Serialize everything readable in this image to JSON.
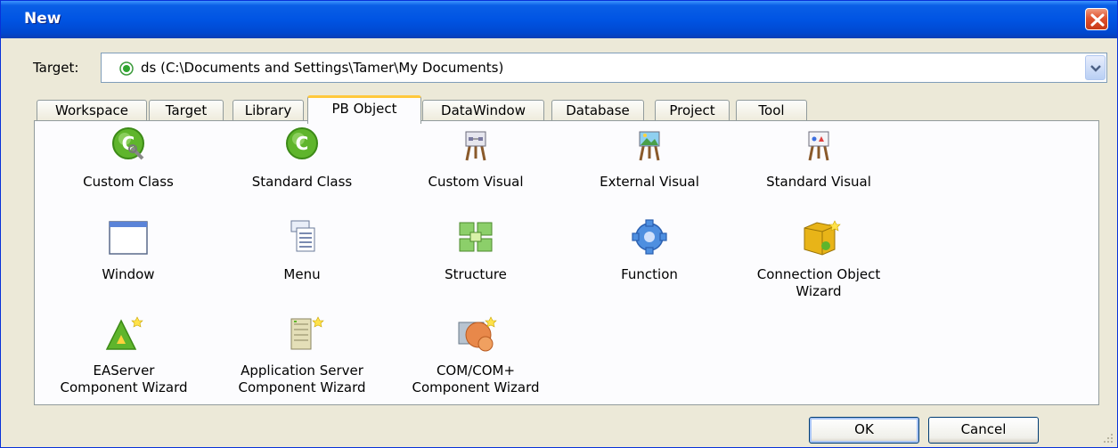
{
  "window": {
    "title": "New"
  },
  "target": {
    "label": "Target:",
    "value": "ds (C:\\Documents and Settings\\Tamer\\My Documents)"
  },
  "tabs": [
    {
      "label": "Workspace",
      "active": false
    },
    {
      "label": "Target",
      "active": false
    },
    {
      "label": "Library",
      "active": false
    },
    {
      "label": "PB Object",
      "active": true
    },
    {
      "label": "DataWindow",
      "active": false
    },
    {
      "label": "Database",
      "active": false
    },
    {
      "label": "Project",
      "active": false
    },
    {
      "label": "Tool",
      "active": false
    }
  ],
  "items": [
    {
      "label": "Custom Class",
      "icon": "custom-class-icon"
    },
    {
      "label": "Standard Class",
      "icon": "standard-class-icon"
    },
    {
      "label": "Custom Visual",
      "icon": "custom-visual-icon"
    },
    {
      "label": "External Visual",
      "icon": "external-visual-icon"
    },
    {
      "label": "Standard Visual",
      "icon": "standard-visual-icon"
    },
    {
      "label": "Window",
      "icon": "window-icon"
    },
    {
      "label": "Menu",
      "icon": "menu-icon"
    },
    {
      "label": "Structure",
      "icon": "structure-icon"
    },
    {
      "label": "Function",
      "icon": "function-icon"
    },
    {
      "label1": "Connection Object",
      "label2": "Wizard",
      "icon": "connection-wizard-icon"
    },
    {
      "label1": "EAServer",
      "label2": "Component Wizard",
      "icon": "easerver-wizard-icon"
    },
    {
      "label1": "Application Server",
      "label2": "Component Wizard",
      "icon": "app-server-wizard-icon"
    },
    {
      "label1": "COM/COM+",
      "label2": "Component Wizard",
      "icon": "com-wizard-icon"
    }
  ],
  "buttons": {
    "ok": "OK",
    "cancel": "Cancel"
  },
  "colors": {
    "titlebar": "#0054e3",
    "dialog_bg": "#ece9d8",
    "active_tab_accent": "#ffc83c"
  }
}
